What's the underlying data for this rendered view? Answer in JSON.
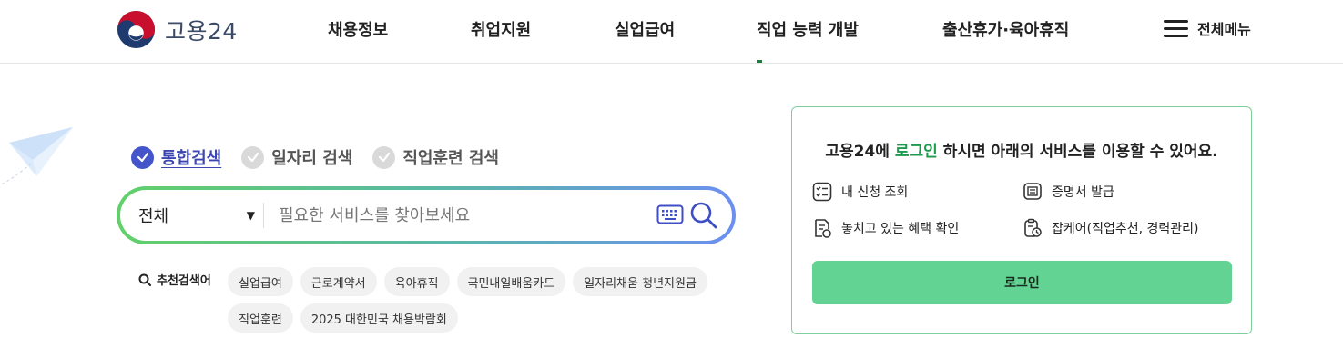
{
  "header": {
    "logo_text": "고용24",
    "nav": [
      "채용정보",
      "취업지원",
      "실업급여",
      "직업 능력 개발",
      "출산휴가·육아휴직"
    ],
    "active_nav": "직업 능력 개발",
    "all_menu_label": "전체메뉴"
  },
  "search": {
    "tabs": [
      {
        "label": "통합검색",
        "active": true
      },
      {
        "label": "일자리 검색",
        "active": false
      },
      {
        "label": "직업훈련 검색",
        "active": false
      }
    ],
    "category_value": "전체",
    "placeholder": "필요한 서비스를 찾아보세요",
    "recommended_label": "추천검색어",
    "recommended": [
      "실업급여",
      "근로계약서",
      "육아휴직",
      "국민내일배움카드",
      "일자리채움 청년지원금",
      "직업훈련",
      "2025 대한민국 채용박람회"
    ]
  },
  "login_box": {
    "title_prefix": "고용24에 ",
    "title_accent": "로그인",
    "title_suffix": " 하시면 아래의 서비스를 이용할 수 있어요.",
    "services": [
      "내 신청 조회",
      "증명서 발급",
      "놓치고 있는 혜택 확인",
      "잡케어(직업추천, 경력관리)"
    ],
    "login_button": "로그인"
  },
  "colors": {
    "accent_green": "#1d9b4c",
    "login_button": "#62d392",
    "tab_active": "#4455cc",
    "logo_red": "#c8102e",
    "logo_blue": "#1f3a6e"
  }
}
